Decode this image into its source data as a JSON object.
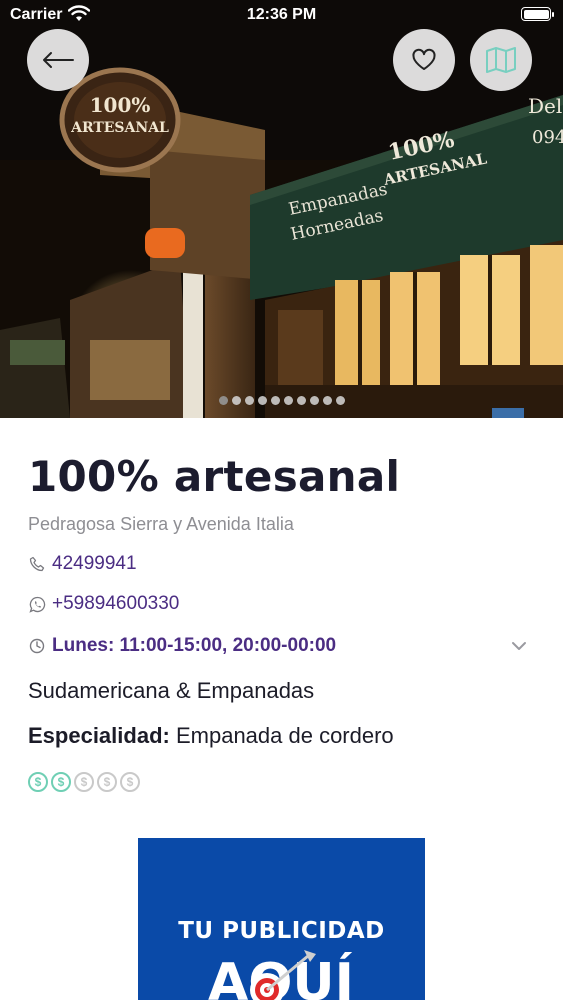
{
  "status_bar": {
    "carrier": "Carrier",
    "time": "12:36 PM"
  },
  "hero": {
    "image_name": "restaurant-storefront-photo",
    "sign_brand": "100% ARTESANAL",
    "sign_text": "Empanadas Horneadas",
    "sign_partial": "Del",
    "sign_partial_number": "094",
    "photo_count": 10,
    "active_photo": 0
  },
  "navigation": {
    "back_icon": "arrow-left-icon",
    "favorite_icon": "heart-icon",
    "map_icon": "map-icon"
  },
  "restaurant": {
    "name": "100% artesanal",
    "address": "Pedragosa Sierra y Avenida Italia",
    "phone": "42499941",
    "whatsapp": "+59894600330",
    "hours": "Lunes: 11:00-15:00, 20:00-00:00",
    "category": "Sudamericana & Empanadas",
    "specialty_label": "Especialidad:",
    "specialty_value": "Empanada de cordero",
    "price_symbol": "$",
    "price_level": 2,
    "price_max": 5
  },
  "ad": {
    "line1": "TU PUBLICIDAD",
    "line2": "AQUÍ"
  },
  "colors": {
    "accent_purple": "#4b2d83",
    "coin_active": "#6fcfb4",
    "coin_inactive": "#c9c9c9",
    "ad_blue": "#0a4aa8"
  }
}
